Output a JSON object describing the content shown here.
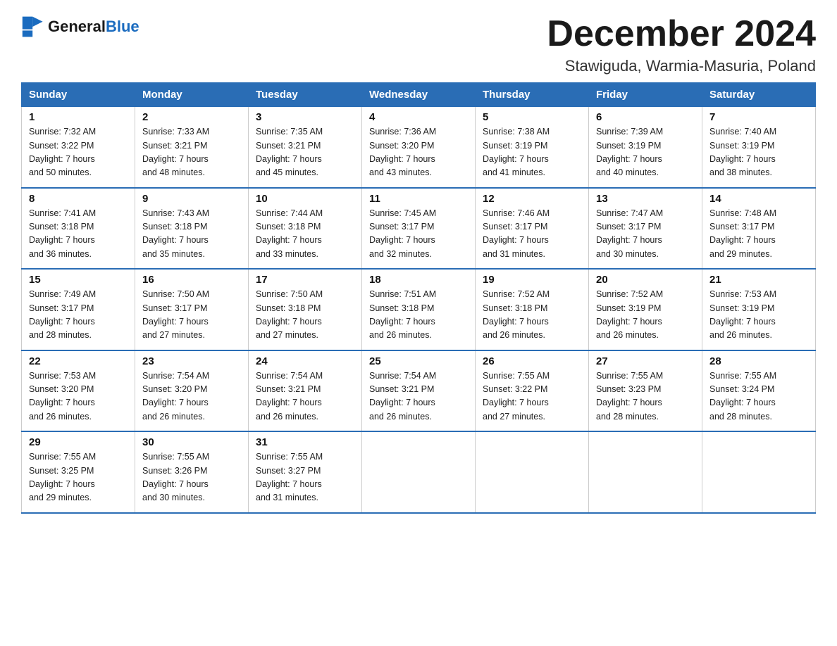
{
  "header": {
    "logo_general": "General",
    "logo_blue": "Blue",
    "month_title": "December 2024",
    "location": "Stawiguda, Warmia-Masuria, Poland"
  },
  "days_of_week": [
    "Sunday",
    "Monday",
    "Tuesday",
    "Wednesday",
    "Thursday",
    "Friday",
    "Saturday"
  ],
  "weeks": [
    [
      {
        "day": "1",
        "sunrise": "7:32 AM",
        "sunset": "3:22 PM",
        "daylight": "7 hours and 50 minutes."
      },
      {
        "day": "2",
        "sunrise": "7:33 AM",
        "sunset": "3:21 PM",
        "daylight": "7 hours and 48 minutes."
      },
      {
        "day": "3",
        "sunrise": "7:35 AM",
        "sunset": "3:21 PM",
        "daylight": "7 hours and 45 minutes."
      },
      {
        "day": "4",
        "sunrise": "7:36 AM",
        "sunset": "3:20 PM",
        "daylight": "7 hours and 43 minutes."
      },
      {
        "day": "5",
        "sunrise": "7:38 AM",
        "sunset": "3:19 PM",
        "daylight": "7 hours and 41 minutes."
      },
      {
        "day": "6",
        "sunrise": "7:39 AM",
        "sunset": "3:19 PM",
        "daylight": "7 hours and 40 minutes."
      },
      {
        "day": "7",
        "sunrise": "7:40 AM",
        "sunset": "3:19 PM",
        "daylight": "7 hours and 38 minutes."
      }
    ],
    [
      {
        "day": "8",
        "sunrise": "7:41 AM",
        "sunset": "3:18 PM",
        "daylight": "7 hours and 36 minutes."
      },
      {
        "day": "9",
        "sunrise": "7:43 AM",
        "sunset": "3:18 PM",
        "daylight": "7 hours and 35 minutes."
      },
      {
        "day": "10",
        "sunrise": "7:44 AM",
        "sunset": "3:18 PM",
        "daylight": "7 hours and 33 minutes."
      },
      {
        "day": "11",
        "sunrise": "7:45 AM",
        "sunset": "3:17 PM",
        "daylight": "7 hours and 32 minutes."
      },
      {
        "day": "12",
        "sunrise": "7:46 AM",
        "sunset": "3:17 PM",
        "daylight": "7 hours and 31 minutes."
      },
      {
        "day": "13",
        "sunrise": "7:47 AM",
        "sunset": "3:17 PM",
        "daylight": "7 hours and 30 minutes."
      },
      {
        "day": "14",
        "sunrise": "7:48 AM",
        "sunset": "3:17 PM",
        "daylight": "7 hours and 29 minutes."
      }
    ],
    [
      {
        "day": "15",
        "sunrise": "7:49 AM",
        "sunset": "3:17 PM",
        "daylight": "7 hours and 28 minutes."
      },
      {
        "day": "16",
        "sunrise": "7:50 AM",
        "sunset": "3:17 PM",
        "daylight": "7 hours and 27 minutes."
      },
      {
        "day": "17",
        "sunrise": "7:50 AM",
        "sunset": "3:18 PM",
        "daylight": "7 hours and 27 minutes."
      },
      {
        "day": "18",
        "sunrise": "7:51 AM",
        "sunset": "3:18 PM",
        "daylight": "7 hours and 26 minutes."
      },
      {
        "day": "19",
        "sunrise": "7:52 AM",
        "sunset": "3:18 PM",
        "daylight": "7 hours and 26 minutes."
      },
      {
        "day": "20",
        "sunrise": "7:52 AM",
        "sunset": "3:19 PM",
        "daylight": "7 hours and 26 minutes."
      },
      {
        "day": "21",
        "sunrise": "7:53 AM",
        "sunset": "3:19 PM",
        "daylight": "7 hours and 26 minutes."
      }
    ],
    [
      {
        "day": "22",
        "sunrise": "7:53 AM",
        "sunset": "3:20 PM",
        "daylight": "7 hours and 26 minutes."
      },
      {
        "day": "23",
        "sunrise": "7:54 AM",
        "sunset": "3:20 PM",
        "daylight": "7 hours and 26 minutes."
      },
      {
        "day": "24",
        "sunrise": "7:54 AM",
        "sunset": "3:21 PM",
        "daylight": "7 hours and 26 minutes."
      },
      {
        "day": "25",
        "sunrise": "7:54 AM",
        "sunset": "3:21 PM",
        "daylight": "7 hours and 26 minutes."
      },
      {
        "day": "26",
        "sunrise": "7:55 AM",
        "sunset": "3:22 PM",
        "daylight": "7 hours and 27 minutes."
      },
      {
        "day": "27",
        "sunrise": "7:55 AM",
        "sunset": "3:23 PM",
        "daylight": "7 hours and 28 minutes."
      },
      {
        "day": "28",
        "sunrise": "7:55 AM",
        "sunset": "3:24 PM",
        "daylight": "7 hours and 28 minutes."
      }
    ],
    [
      {
        "day": "29",
        "sunrise": "7:55 AM",
        "sunset": "3:25 PM",
        "daylight": "7 hours and 29 minutes."
      },
      {
        "day": "30",
        "sunrise": "7:55 AM",
        "sunset": "3:26 PM",
        "daylight": "7 hours and 30 minutes."
      },
      {
        "day": "31",
        "sunrise": "7:55 AM",
        "sunset": "3:27 PM",
        "daylight": "7 hours and 31 minutes."
      },
      null,
      null,
      null,
      null
    ]
  ],
  "labels": {
    "sunrise": "Sunrise: ",
    "sunset": "Sunset: ",
    "daylight": "Daylight: "
  }
}
